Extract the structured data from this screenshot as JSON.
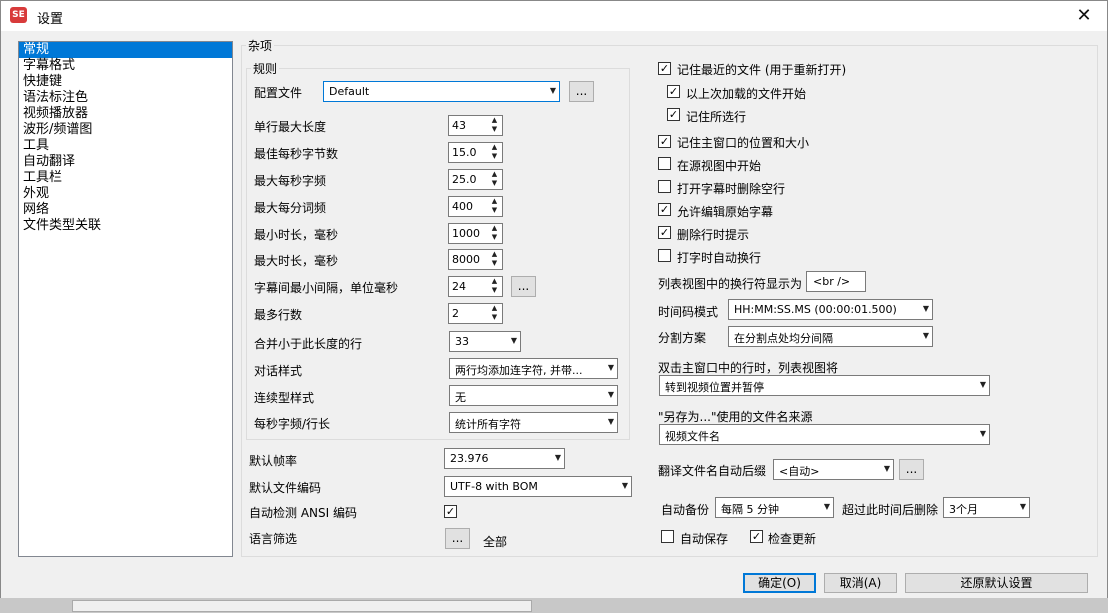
{
  "window": {
    "title": "设置",
    "icon_text": "SE",
    "close_icon": "close-icon"
  },
  "nav": {
    "items": [
      "常规",
      "字幕格式",
      "快捷键",
      "语法标注色",
      "视频播放器",
      "波形/频谱图",
      "工具",
      "自动翻译",
      "工具栏",
      "外观",
      "网络",
      "文件类型关联"
    ],
    "selected": 0
  },
  "misc": {
    "group_title": "杂项",
    "rules": {
      "group_title": "规则",
      "profile_label": "配置文件",
      "profile_value": "Default",
      "browse": "...",
      "single_line_max_label": "单行最大长度",
      "single_line_max": "43",
      "optimal_cps_label": "最佳每秒字节数",
      "optimal_cps": "15.0",
      "max_cps_label": "最大每秒字频",
      "max_cps": "25.0",
      "max_wpm_label": "最大每分词频",
      "max_wpm": "400",
      "min_duration_label": "最小时长，毫秒",
      "min_duration": "1000",
      "max_duration_label": "最大时长，毫秒",
      "max_duration": "8000",
      "min_gap_label": "字幕间最小间隔，单位毫秒",
      "min_gap": "24",
      "max_lines_label": "最多行数",
      "max_lines": "2",
      "merge_label": "合并小于此长度的行",
      "merge_value": "33",
      "dialog_style_label": "对话样式",
      "dialog_style": "两行均添加连字符, 并带...",
      "continuation_label": "连续型样式",
      "continuation": "无",
      "cps_line_label": "每秒字频/行长",
      "cps_line": "统计所有字符"
    },
    "default_fps_label": "默认帧率",
    "default_fps": "23.976",
    "default_encoding_label": "默认文件编码",
    "default_encoding": "UTF-8 with BOM",
    "auto_detect_ansi_label": "自动检测 ANSI 编码",
    "auto_detect_ansi": true,
    "language_filter_label": "语言筛选",
    "language_filter_btn": "...",
    "language_filter_value": "全部",
    "right": {
      "remember_recent": {
        "label": "记住最近的文件 (用于重新打开)",
        "checked": true
      },
      "start_last_file": {
        "label": "以上次加载的文件开始",
        "checked": true
      },
      "remember_selected": {
        "label": "记住所选行",
        "checked": true
      },
      "remember_window": {
        "label": "记住主窗口的位置和大小",
        "checked": true
      },
      "start_source_view": {
        "label": "在源视图中开始",
        "checked": false
      },
      "remove_blank": {
        "label": "打开字幕时删除空行",
        "checked": false
      },
      "allow_edit_original": {
        "label": "允许编辑原始字幕",
        "checked": true
      },
      "prompt_delete": {
        "label": "删除行时提示",
        "checked": true
      },
      "auto_wrap": {
        "label": "打字时自动换行",
        "checked": false
      },
      "linebreak_label": "列表视图中的换行符显示为",
      "linebreak_value": "<br />",
      "timecode_label": "时间码模式",
      "timecode_value": "HH:MM:SS.MS (00:00:01.500)",
      "split_label": "分割方案",
      "split_value": "在分割点处均分间隔",
      "dblclick_label": "双击主窗口中的行时，列表视图将",
      "dblclick_value": "转到视频位置并暂停",
      "saveas_label": "\"另存为...\"使用的文件名来源",
      "saveas_value": "视频文件名",
      "translate_suffix_label": "翻译文件名自动后缀",
      "translate_suffix_value": "<自动>",
      "translate_suffix_btn": "...",
      "autobackup_label": "自动备份",
      "autobackup_value": "每隔 5 分钟",
      "delete_after_label": "超过此时间后删除",
      "delete_after_value": "3个月",
      "autosave": {
        "label": "自动保存",
        "checked": false
      },
      "check_updates": {
        "label": "检查更新",
        "checked": true
      }
    }
  },
  "buttons": {
    "ok": "确定(O)",
    "cancel": "取消(A)",
    "restore": "还原默认设置"
  }
}
